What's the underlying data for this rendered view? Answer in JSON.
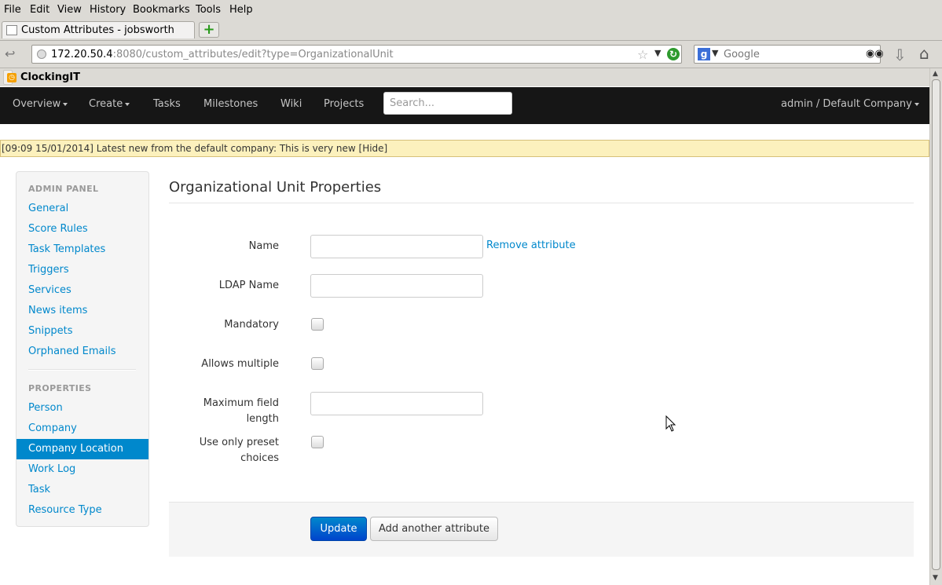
{
  "browser": {
    "menu": [
      "File",
      "Edit",
      "View",
      "History",
      "Bookmarks",
      "Tools",
      "Help"
    ],
    "tab_title": "Custom Attributes - jobsworth",
    "new_tab": "+",
    "url_host": "172.20.50.4",
    "url_rest": ":8080/custom_attributes/edit?type=OrganizationalUnit",
    "search_engine": "Google",
    "bookmark": "ClockingIT"
  },
  "nav": {
    "overview": "Overview",
    "create": "Create",
    "tasks": "Tasks",
    "milestones": "Milestones",
    "wiki": "Wiki",
    "projects": "Projects",
    "search_placeholder": "Search...",
    "user": "admin / Default Company"
  },
  "news": "[09:09 15/01/2014] Latest new from the default company: This is very new [Hide]",
  "sidebar": {
    "admin_header": "ADMIN PANEL",
    "admin_items": [
      "General",
      "Score Rules",
      "Task Templates",
      "Triggers",
      "Services",
      "News items",
      "Snippets",
      "Orphaned Emails"
    ],
    "properties_header": "PROPERTIES",
    "property_items": [
      "Person",
      "Company",
      "Company Location",
      "Work Log",
      "Task",
      "Resource Type"
    ],
    "active": "Company Location"
  },
  "page": {
    "title": "Organizational Unit Properties",
    "fields": {
      "name": "Name",
      "ldap_name": "LDAP Name",
      "mandatory": "Mandatory",
      "allows_multiple": "Allows multiple",
      "max_length": "Maximum field length",
      "preset_line1": "Use only preset",
      "preset_line2": "choices"
    },
    "remove_link": "Remove attribute",
    "update_button": "Update",
    "add_button": "Add another attribute"
  },
  "colors": {
    "accent": "#0088cc",
    "navbar": "#161616",
    "news_bg": "#fcf1bd"
  }
}
